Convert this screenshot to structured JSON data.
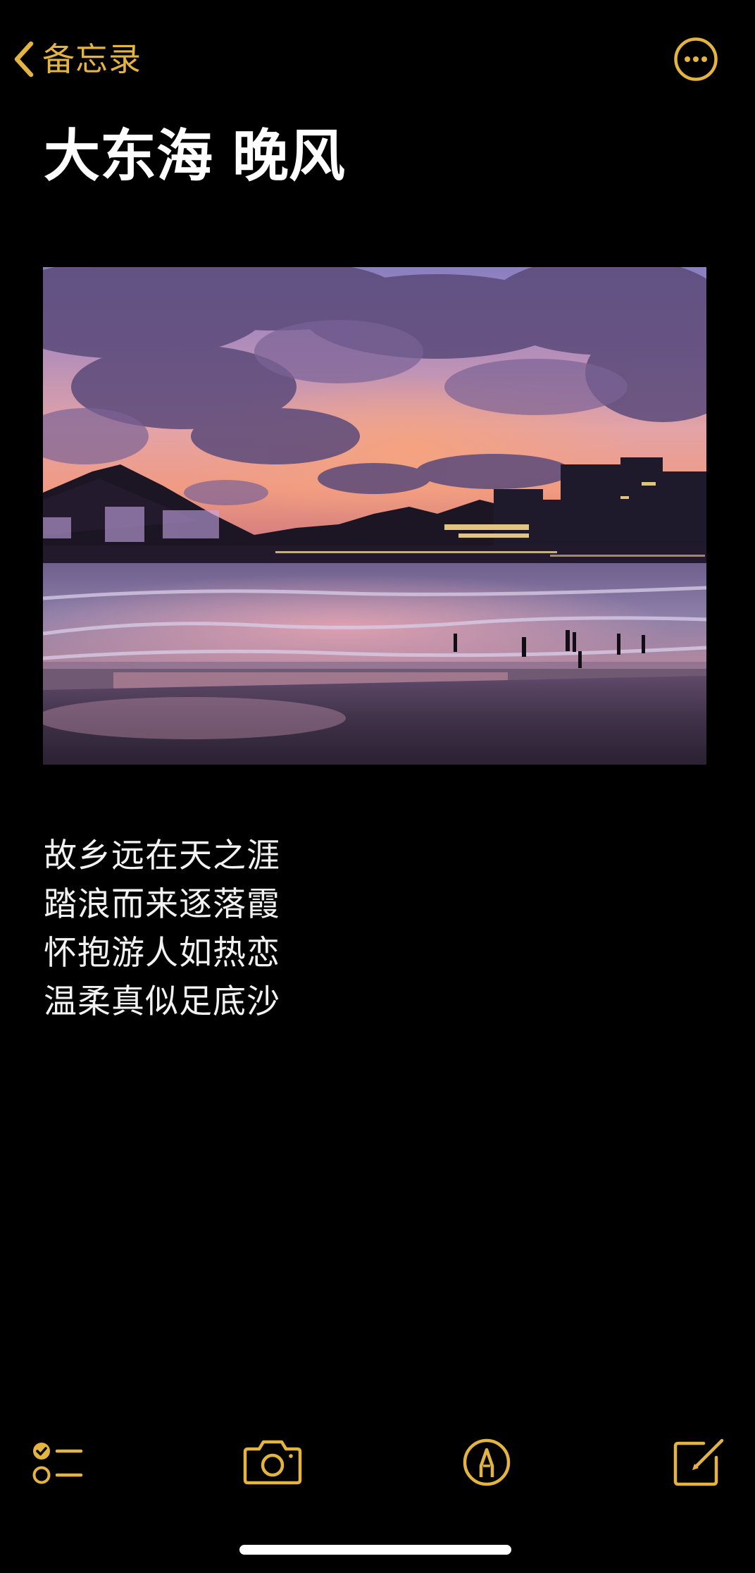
{
  "nav": {
    "back_label": "备忘录",
    "back_icon": "chevron-left-icon",
    "more_icon": "ellipsis-circle-icon"
  },
  "note": {
    "title": "大东海 晚风",
    "image_alt": "大东海 晚风",
    "lines": [
      "故乡远在天之涯",
      "踏浪而来逐落霞",
      "怀抱游人如热恋",
      "温柔真似足底沙"
    ]
  },
  "toolbar": {
    "checklist_icon": "checklist-icon",
    "camera_icon": "camera-icon",
    "markup_icon": "pen-markup-icon",
    "compose_icon": "compose-icon"
  },
  "colors": {
    "accent": "#E3B43F",
    "background": "#000000",
    "text": "#FFFFFF"
  }
}
